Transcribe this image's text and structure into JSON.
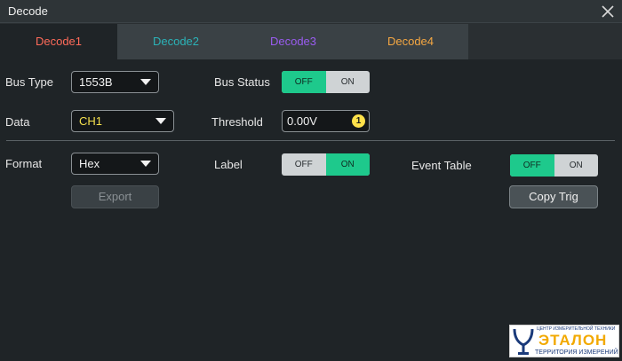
{
  "window": {
    "title": "Decode"
  },
  "tabs": [
    {
      "label": "Decode1",
      "color": "#ff6b5a"
    },
    {
      "label": "Decode2",
      "color": "#2bb3b8"
    },
    {
      "label": "Decode3",
      "color": "#9a5cf0"
    },
    {
      "label": "Decode4",
      "color": "#f5a742"
    }
  ],
  "bus_type": {
    "label": "Bus Type",
    "value": "1553B"
  },
  "bus_status": {
    "label": "Bus Status",
    "off": "OFF",
    "on": "ON",
    "state": "OFF"
  },
  "data": {
    "label": "Data",
    "value": "CH1",
    "value_color": "#f4e04d"
  },
  "threshold": {
    "label": "Threshold",
    "value": "0.00V",
    "knob": "1"
  },
  "format": {
    "label": "Format",
    "value": "Hex"
  },
  "label_toggle": {
    "label": "Label",
    "off": "OFF",
    "on": "ON",
    "state": "ON"
  },
  "event_table": {
    "label": "Event Table",
    "off": "OFF",
    "on": "ON",
    "state": "OFF"
  },
  "buttons": {
    "export": "Export",
    "copy_trig": "Copy Trig"
  },
  "watermark": {
    "top": "ЦЕНТР ИЗМЕРИТЕЛЬНОЙ ТЕХНИКИ",
    "main": "ЭТАЛОН",
    "bottom": "ТЕРРИТОРИЯ ИЗМЕРЕНИЙ"
  },
  "colors": {
    "accent_on": "#1ec98c",
    "knob": "#ffe14a"
  }
}
